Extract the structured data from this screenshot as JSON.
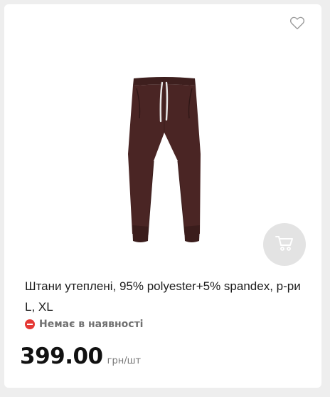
{
  "product": {
    "title": "Штани утеплені, 95% polyester+5% spandex, р-ри L, XL",
    "availability": "Немає в наявності",
    "price": "399.00",
    "price_unit": "грн/шт",
    "image": "brown-jogger-pants"
  },
  "icons": {
    "favorite": "heart-outline-icon",
    "cart": "cart-icon",
    "availability": "minus-circle-icon"
  },
  "colors": {
    "availability_status": "#e53935",
    "product_brown": "#4a2524",
    "cart_button_bg": "#e3e3e3"
  }
}
